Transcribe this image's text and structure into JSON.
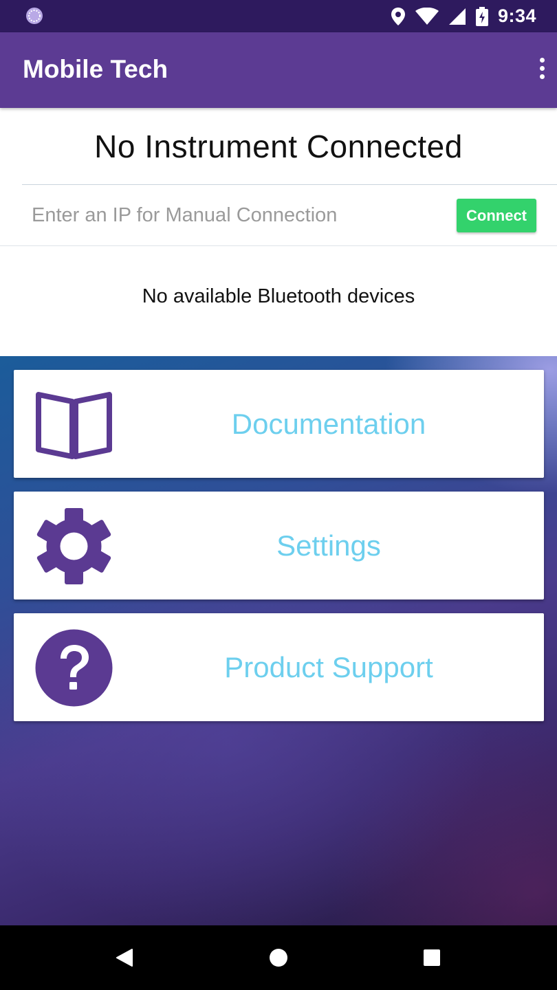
{
  "status_bar": {
    "time": "9:34",
    "icons": [
      "app-activity-icon",
      "location-icon",
      "wifi-icon",
      "cell-signal-icon",
      "battery-charging-icon"
    ]
  },
  "app_bar": {
    "title": "Mobile Tech",
    "overflow_icon": "more-vert-icon"
  },
  "connection": {
    "status": "No Instrument Connected",
    "ip_placeholder": "Enter an IP for Manual Connection",
    "ip_value": "",
    "connect_label": "Connect",
    "bluetooth_message": "No available Bluetooth devices"
  },
  "menu": {
    "items": [
      {
        "label": "Documentation",
        "icon": "book-icon"
      },
      {
        "label": "Settings",
        "icon": "gear-icon"
      },
      {
        "label": "Product Support",
        "icon": "help-icon"
      }
    ]
  },
  "nav_bar": {
    "buttons": [
      "back-icon",
      "home-icon",
      "recents-icon"
    ]
  },
  "colors": {
    "status_bar": "#2e1a5e",
    "app_bar": "#5c3b93",
    "accent_purple": "#5b3a92",
    "menu_text": "#6dcfee",
    "connect_button": "#33d26c"
  }
}
